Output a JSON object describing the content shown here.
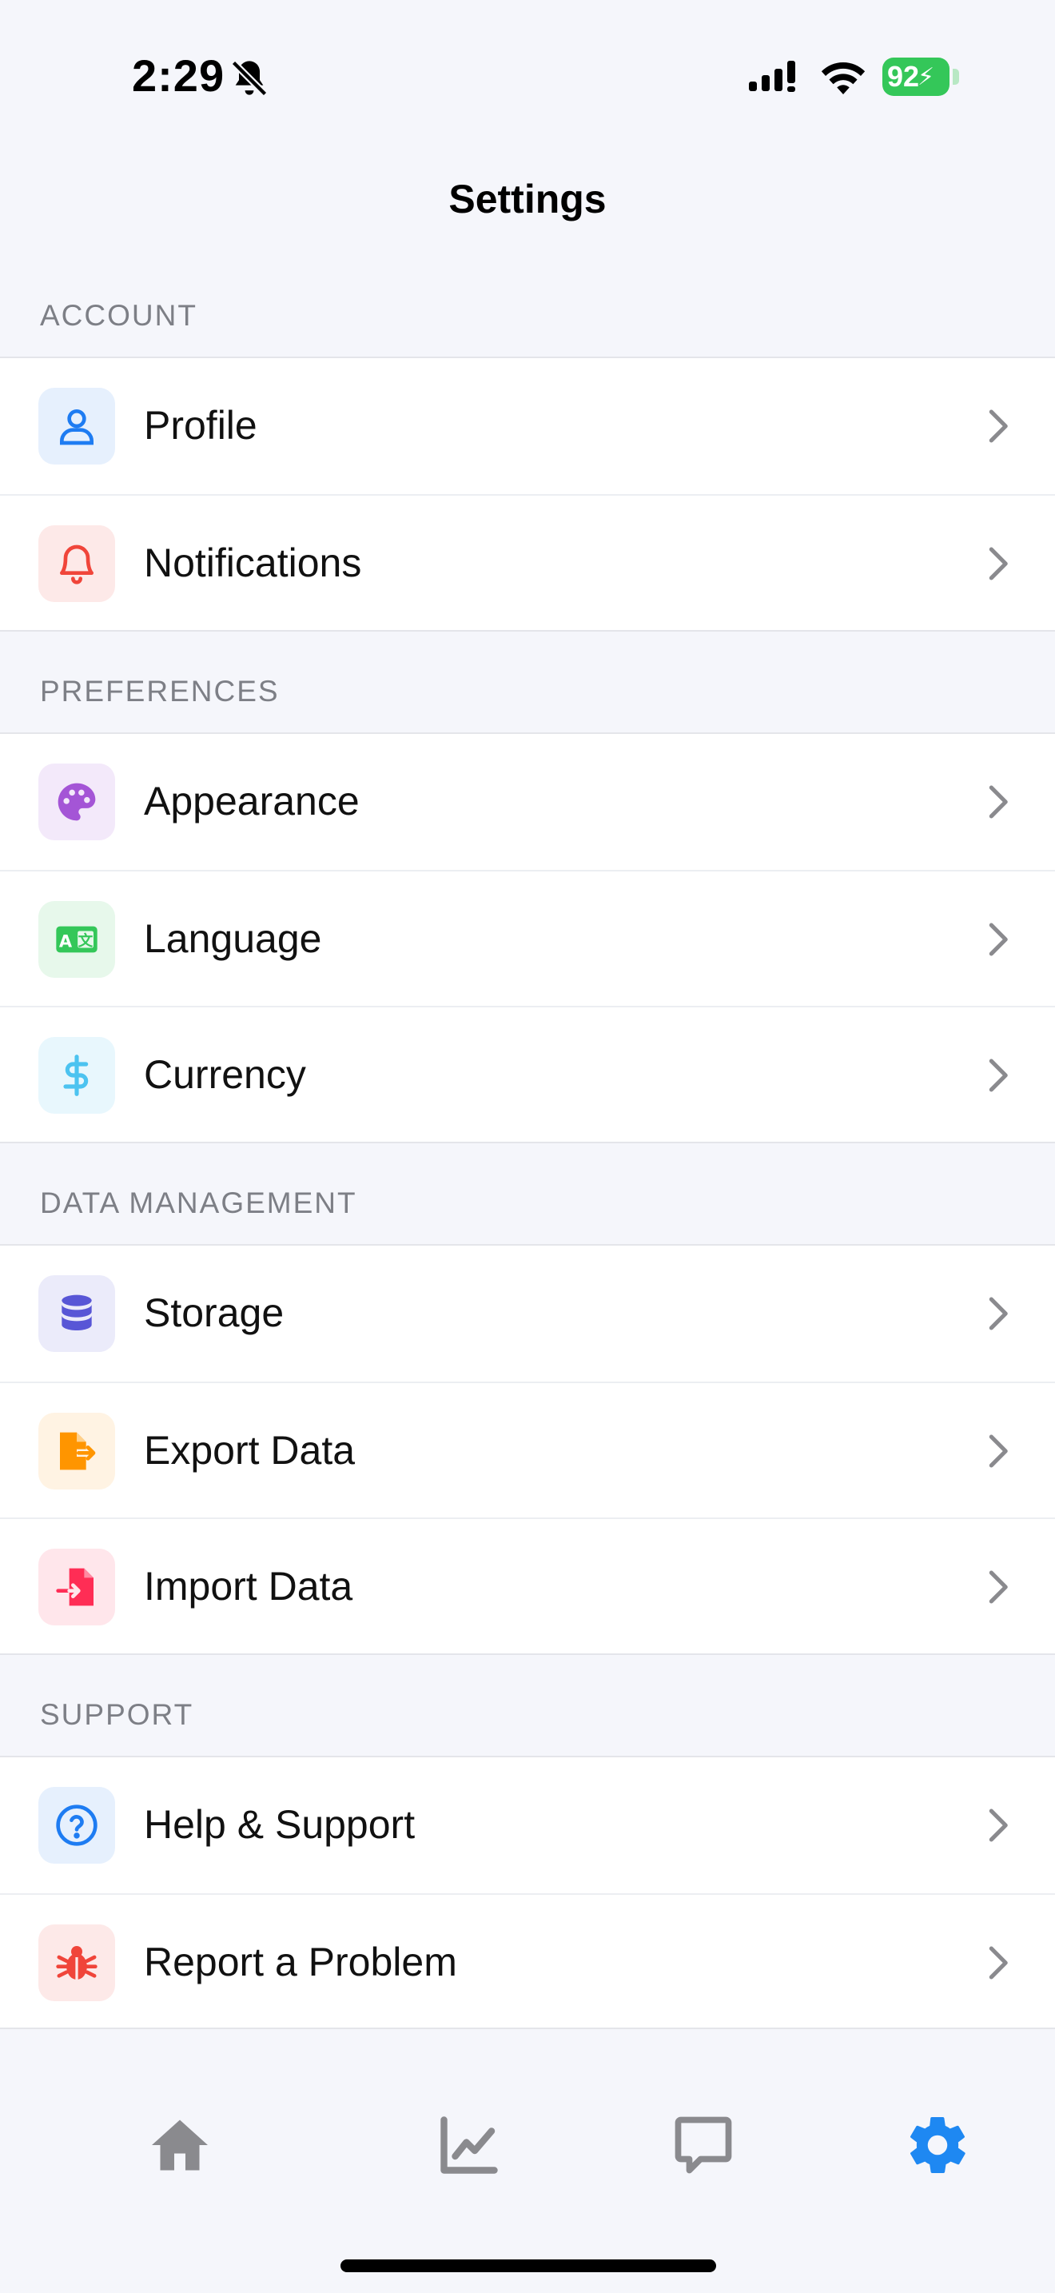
{
  "status": {
    "time": "2:29",
    "battery": "92"
  },
  "header": {
    "title": "Settings"
  },
  "sections": [
    {
      "title": "ACCOUNT",
      "items": [
        {
          "label": "Profile",
          "icon": "person-icon",
          "color": "#1e7cf2",
          "bg": "#e6f0fd"
        },
        {
          "label": "Notifications",
          "icon": "bell-icon",
          "color": "#f0453a",
          "bg": "#fde9e8"
        }
      ]
    },
    {
      "title": "PREFERENCES",
      "items": [
        {
          "label": "Appearance",
          "icon": "palette-icon",
          "color": "#a455d6",
          "bg": "#f3e9fa"
        },
        {
          "label": "Language",
          "icon": "language-icon",
          "color": "#34c759",
          "bg": "#e7f8eb"
        },
        {
          "label": "Currency",
          "icon": "dollar-icon",
          "color": "#4cc3f0",
          "bg": "#e8f7fd"
        }
      ]
    },
    {
      "title": "DATA MANAGEMENT",
      "items": [
        {
          "label": "Storage",
          "icon": "database-icon",
          "color": "#5856d6",
          "bg": "#ebebfa"
        },
        {
          "label": "Export Data",
          "icon": "file-export-icon",
          "color": "#ff9500",
          "bg": "#fff3e3"
        },
        {
          "label": "Import Data",
          "icon": "file-import-icon",
          "color": "#ff2d55",
          "bg": "#ffe6eb"
        }
      ]
    },
    {
      "title": "SUPPORT",
      "items": [
        {
          "label": "Help & Support",
          "icon": "help-circle-icon",
          "color": "#1e7cf2",
          "bg": "#e6f0fd"
        },
        {
          "label": "Report a Problem",
          "icon": "bug-icon",
          "color": "#f0453a",
          "bg": "#fde9e8"
        }
      ]
    }
  ],
  "tabs": [
    {
      "name": "home",
      "icon": "home-icon",
      "active": false
    },
    {
      "name": "stats",
      "icon": "chart-line-icon",
      "active": false
    },
    {
      "name": "chat",
      "icon": "chat-bubble-icon",
      "active": false
    },
    {
      "name": "settings",
      "icon": "gear-icon",
      "active": true
    }
  ],
  "colors": {
    "active_tab": "#1e88f2",
    "inactive_tab": "#8a8a8e"
  }
}
